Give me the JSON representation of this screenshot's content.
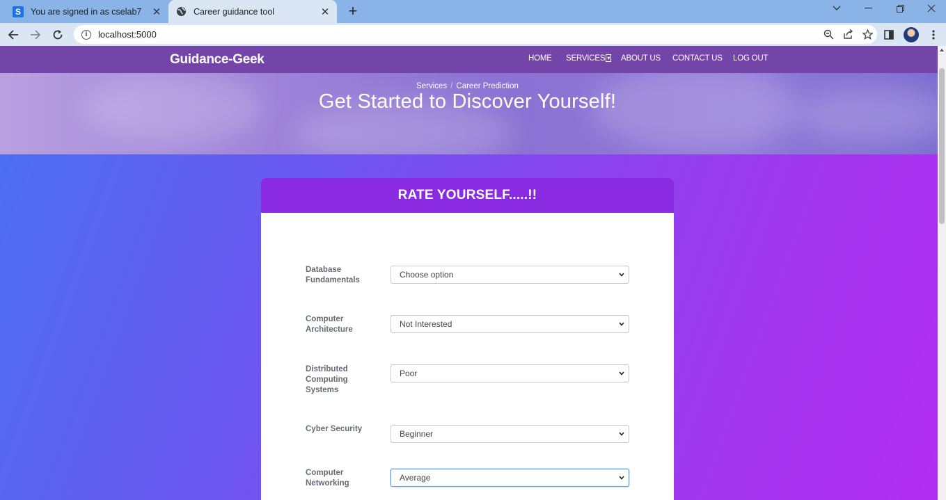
{
  "browser": {
    "tabs": [
      {
        "title": "You are signed in as cselab7",
        "icon": "s-letter-icon"
      },
      {
        "title": "Career guidance tool",
        "icon": "globe-icon"
      }
    ],
    "address": "localhost:5000"
  },
  "site": {
    "brand": "Guidance-Geek",
    "menu": [
      "HOME",
      "SERVICES",
      "ABOUT US",
      "CONTACT US",
      "LOG OUT"
    ],
    "breadcrumb": [
      "Services",
      "Career Prediction"
    ],
    "hero_title": "Get Started to Discover Yourself!"
  },
  "form": {
    "header": "RATE YOURSELF.....!!",
    "fields": [
      {
        "label": "Database Fundamentals",
        "value": "Choose option"
      },
      {
        "label": "Computer Architecture",
        "value": "Not Interested"
      },
      {
        "label": "Distributed Computing Systems",
        "value": "Poor"
      },
      {
        "label": "Cyber Security",
        "value": "Beginner"
      },
      {
        "label": "Computer Networking",
        "value": "Average"
      }
    ]
  },
  "colors": {
    "navbar": "#7345a8",
    "card_header": "#8a2be2",
    "gradient_start": "#4c6ef0",
    "gradient_end": "#b22df2"
  }
}
